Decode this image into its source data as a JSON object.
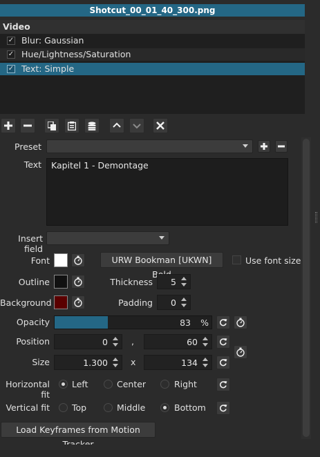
{
  "window": {
    "title": "Shotcut_00_01_40_300.png"
  },
  "filters": {
    "section_label": "Video",
    "items": [
      {
        "label": "Blur: Gaussian",
        "checked": true,
        "selected": false
      },
      {
        "label": "Hue/Lightness/Saturation",
        "checked": true,
        "selected": false
      },
      {
        "label": "Text: Simple",
        "checked": true,
        "selected": true
      }
    ],
    "check_glyph": "✓"
  },
  "toolbar": {
    "buttons": [
      "add-icon",
      "remove-icon",
      "copy-icon",
      "paste-icon",
      "save-stack-icon",
      "move-up-icon",
      "move-down-icon",
      "deselect-icon"
    ]
  },
  "form": {
    "preset": {
      "label": "Preset",
      "value": ""
    },
    "text": {
      "label": "Text",
      "value": "Kapitel 1 - Demontage"
    },
    "insert_field": {
      "label": "Insert field",
      "value": ""
    },
    "font": {
      "label": "Font",
      "color": "#ffffff",
      "font_button": "URW Bookman [UKWN] Bold",
      "use_font_size_label": "Use font size",
      "use_font_size": false
    },
    "outline": {
      "label": "Outline",
      "color": "#111111"
    },
    "thickness": {
      "label": "Thickness",
      "value": "5"
    },
    "background": {
      "label": "Background",
      "color": "#5a0000"
    },
    "padding": {
      "label": "Padding",
      "value": "0"
    },
    "opacity": {
      "label": "Opacity",
      "value": "83",
      "unit": "%",
      "fraction": 0.83
    },
    "position": {
      "label": "Position",
      "x": "0",
      "separator": ",",
      "y": "60"
    },
    "size": {
      "label": "Size",
      "w": "1.300",
      "separator": "x",
      "h": "134"
    },
    "horizontal_fit": {
      "label": "Horizontal fit",
      "options": [
        "Left",
        "Center",
        "Right"
      ],
      "selected": "Left"
    },
    "vertical_fit": {
      "label": "Vertical fit",
      "options": [
        "Top",
        "Middle",
        "Bottom"
      ],
      "selected": "Bottom"
    },
    "load_keyframes_button": "Load Keyframes from Motion Tracker"
  },
  "colors": {
    "accent": "#246785"
  }
}
